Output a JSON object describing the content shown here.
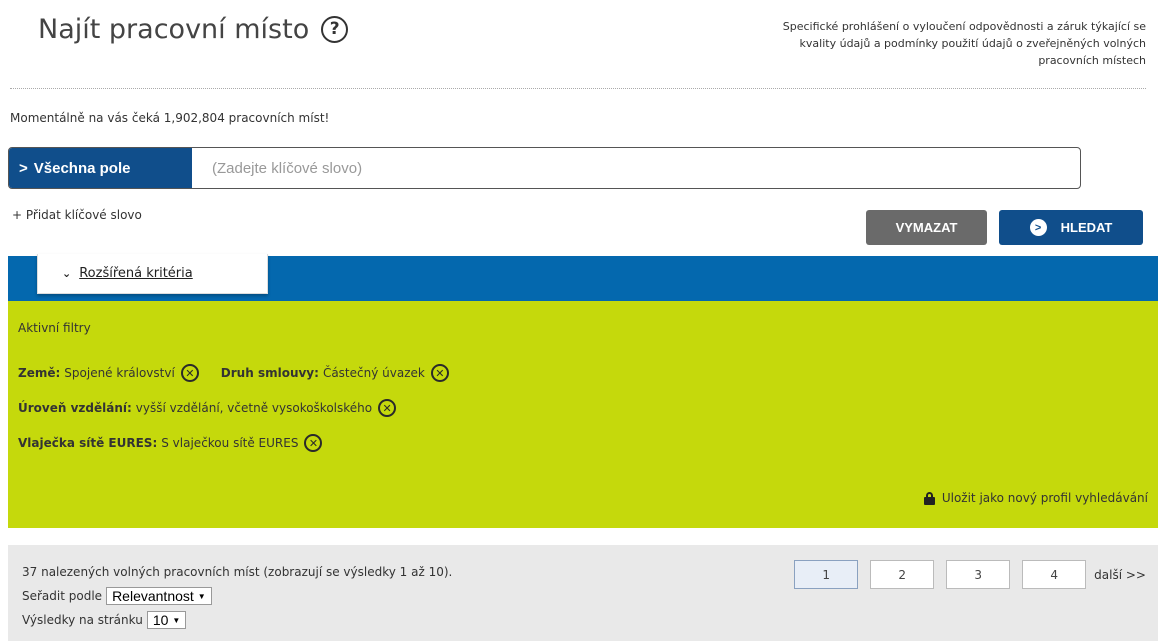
{
  "header": {
    "title": "Najít pracovní místo",
    "help_icon": "help-circle-icon",
    "disclaimer_lines": [
      "Specifické prohlášení o vyloučení odpovědnosti a záruk týkající se",
      "kvality údajů a podmínky použití údajů o zveřejněných volných",
      "pracovních místech"
    ]
  },
  "jobs_count_text": "Momentálně na vás čeká 1,902,804 pracovních míst!",
  "search": {
    "field_label": "Všechna pole",
    "field_icon": "chevron-right-icon",
    "placeholder": "(Zadejte klíčové slovo)",
    "value": "",
    "add_keyword": "+ Přidat klíčové slovo",
    "clear_label": "VYMAZAT",
    "search_label": "HLEDAT"
  },
  "advanced": {
    "label": "Rozšířená kritéria",
    "icon": "chevron-down-icon"
  },
  "filters": {
    "title": "Aktivní filtry",
    "items": [
      {
        "key": "Země:",
        "value": "Spojené království"
      },
      {
        "key": "Druh smlouvy:",
        "value": "Částečný úvazek"
      },
      {
        "key": "Úroveň vzdělání:",
        "value": "vyšší vzdělání, včetně vysokoškolského"
      },
      {
        "key": "Vlaječka sítě EURES:",
        "value": "S vlaječkou sítě EURES"
      }
    ],
    "remove_icon": "remove-circle-icon",
    "save_profile": "Uložit jako nový profil vyhledávání",
    "save_icon": "lock-icon"
  },
  "results": {
    "summary": "37 nalezených volných pracovních míst (zobrazují se výsledky 1 až 10).",
    "sort_label": "Seřadit podle",
    "sort_value": "Relevantnost",
    "per_page_label": "Výsledky na stránku",
    "per_page_value": "10",
    "pages": [
      "1",
      "2",
      "3",
      "4"
    ],
    "current_page": "1",
    "next_label": "další >>"
  },
  "colors": {
    "brand_blue": "#0468ae",
    "dark_blue": "#104e8b",
    "filter_green": "#c5d90c",
    "clear_gray": "#6a6a6a"
  }
}
